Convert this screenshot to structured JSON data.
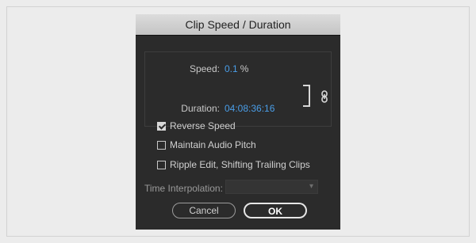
{
  "dialog": {
    "title": "Clip Speed / Duration",
    "speed_label": "Speed:",
    "speed_value": "0.1",
    "speed_unit": "%",
    "duration_label": "Duration:",
    "duration_value": "04:08:36:16",
    "link_icon": "chain-link-icon",
    "options": [
      {
        "label": "Reverse Speed",
        "checked": true
      },
      {
        "label": "Maintain Audio Pitch",
        "checked": false
      },
      {
        "label": "Ripple Edit, Shifting Trailing Clips",
        "checked": false
      }
    ],
    "interpolation_label": "Time Interpolation:",
    "interpolation_value": "",
    "cancel_label": "Cancel",
    "ok_label": "OK"
  },
  "colors": {
    "value_accent": "#4a9ee8",
    "dialog_bg": "#2b2b2b",
    "page_bg": "#ececec"
  }
}
